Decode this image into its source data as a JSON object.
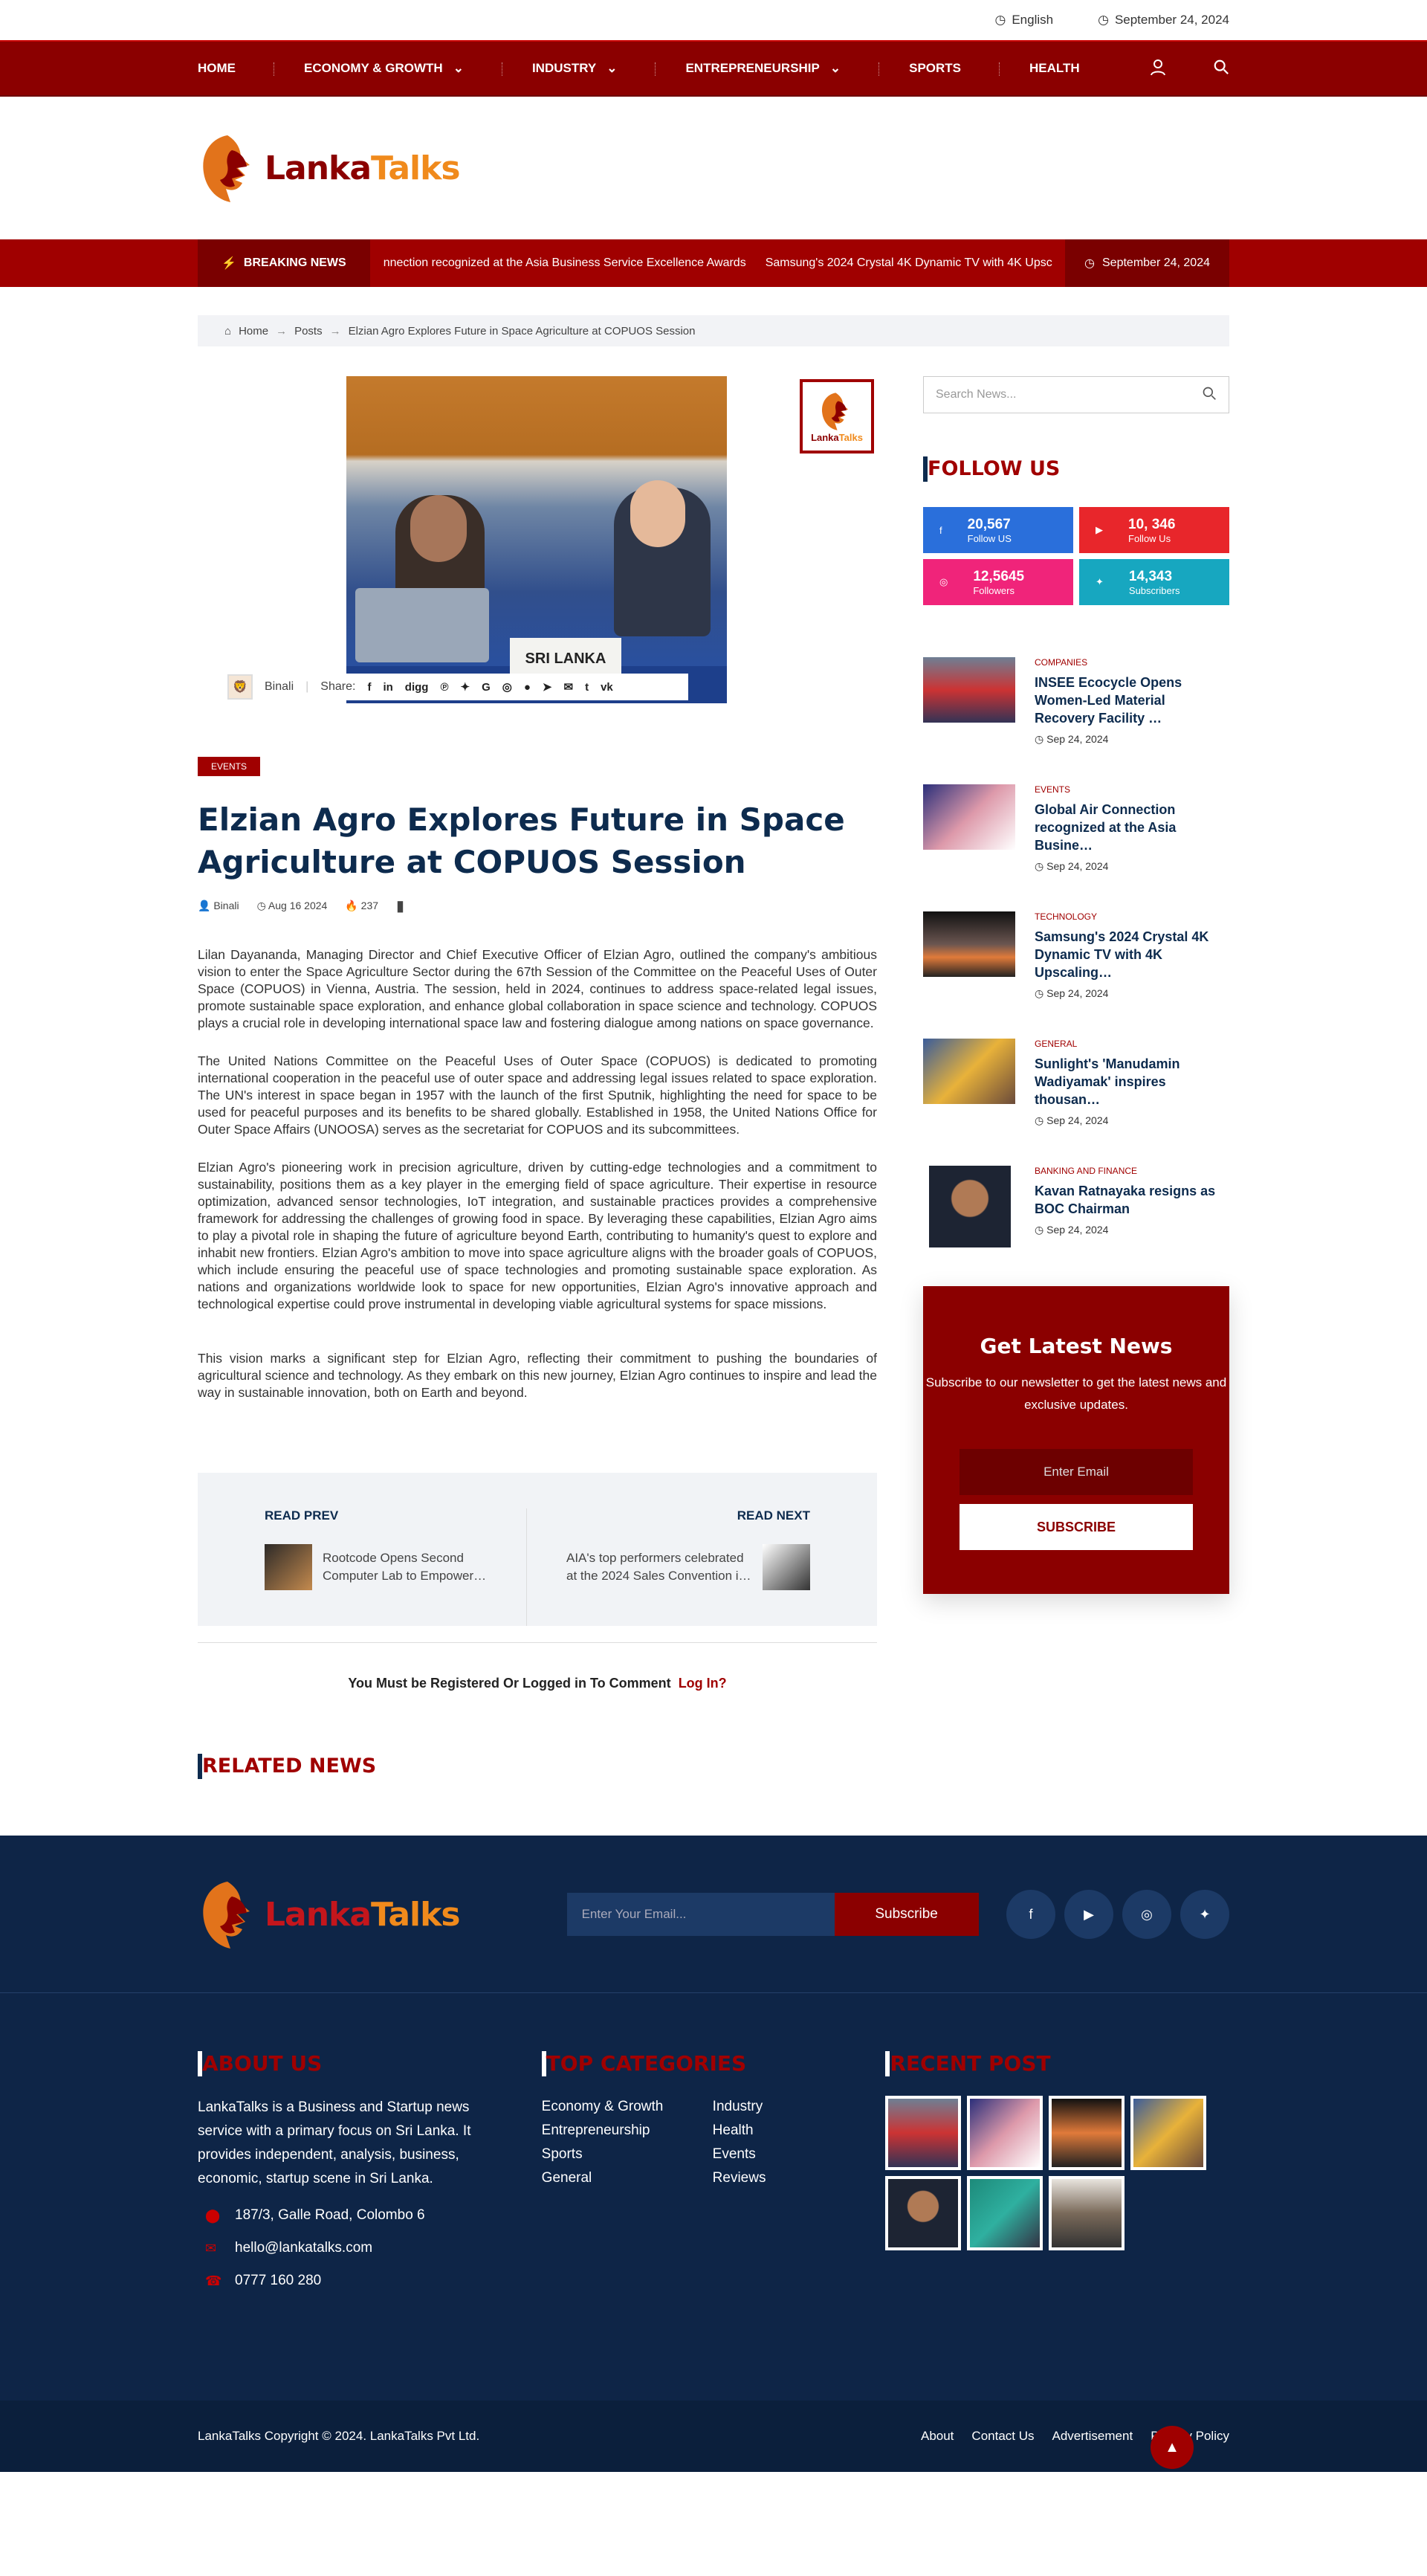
{
  "topbar": {
    "language": "English",
    "date": "September 24, 2024"
  },
  "nav": {
    "items": [
      "HOME",
      "ECONOMY & GROWTH",
      "INDUSTRY",
      "ENTREPRENEURSHIP",
      "SPORTS",
      "HEALTH"
    ]
  },
  "logo": {
    "lanka": "Lanka",
    "talks": "Talks"
  },
  "breaking": {
    "label": "BREAKING NEWS",
    "ticker1": "nnection recognized at the Asia Business Service Excellence Awards",
    "ticker2": "Samsung's 2024 Crystal 4K Dynamic TV with 4K Upsc",
    "date": "September 24, 2024"
  },
  "breadcrumb": {
    "home": "Home",
    "posts": "Posts",
    "current": "Elzian Agro Explores Future in Space Agriculture at COPUOS Session"
  },
  "article": {
    "plate": "SRI LANKA",
    "author": "Binali",
    "share_label": "Share:",
    "category": "EVENTS",
    "title": "Elzian Agro Explores Future in Space Agriculture at COPUOS Session",
    "meta_author": "Binali",
    "meta_date": "Aug 16 2024",
    "meta_views": "237",
    "p1": "Lilan Dayananda, Managing Director and Chief Executive Officer of Elzian Agro, outlined the company's ambitious vision to enter the Space Agriculture Sector during the 67th Session of the Committee on the Peaceful Uses of Outer Space (COPUOS) in Vienna, Austria. The session, held in 2024, continues to address space-related legal issues, promote sustainable space exploration, and enhance global collaboration in space science and technology. COPUOS plays a crucial role in developing international space law and fostering dialogue among nations on space governance.",
    "p2": "The United Nations Committee on the Peaceful Uses of Outer Space (COPUOS) is dedicated to promoting international cooperation in the peaceful use of outer space and addressing legal issues related to space exploration. The UN's interest in space began in 1957 with the launch of the first Sputnik, highlighting the need for space to be used for peaceful purposes and its benefits to be shared globally. Established in 1958, the United Nations Office for Outer Space Affairs (UNOOSA) serves as the secretariat for COPUOS and its subcommittees.",
    "p3": "Elzian Agro's pioneering work in precision agriculture, driven by cutting-edge technologies and a commitment to sustainability, positions them as a key player in the emerging field of space agriculture. Their expertise in resource optimization, advanced sensor technologies, IoT integration, and sustainable practices provides a comprehensive framework for addressing the challenges of growing food in space. By leveraging these capabilities, Elzian Agro aims to play a pivotal role in shaping the future of agriculture beyond Earth, contributing to humanity's quest to explore and inhabit new frontiers. Elzian Agro's ambition to move into space agriculture aligns with the broader goals of COPUOS, which include ensuring the peaceful use of space technologies and promoting sustainable space exploration. As nations and organizations worldwide look to space for new opportunities, Elzian Agro's innovative approach and technological expertise could prove instrumental in developing viable agricultural systems for space missions.",
    "p4": "This vision marks a significant step for Elzian Agro, reflecting their commitment to pushing the boundaries of agricultural science and technology. As they embark on this new journey, Elzian Agro continues to inspire and lead the way in sustainable innovation, both on Earth and beyond."
  },
  "readnav": {
    "prev_label": "READ PREV",
    "prev_title": "Rootcode Opens Second Computer Lab to Empower…",
    "next_label": "READ NEXT",
    "next_title": "AIA's top performers celebrated at the 2024 Sales Convention i…"
  },
  "comment": {
    "text": "You Must be Registered Or Logged in To Comment",
    "login": "Log In?"
  },
  "related_title": "RELATED NEWS",
  "sidebar": {
    "search_placeholder": "Search News...",
    "follow_title": "FOLLOW US",
    "socials": [
      {
        "count": "20,567",
        "label": "Follow US"
      },
      {
        "count": "10, 346",
        "label": "Follow Us"
      },
      {
        "count": "12,5645",
        "label": "Followers"
      },
      {
        "count": "14,343",
        "label": "Subscribers"
      }
    ],
    "posts": [
      {
        "category": "COMPANIES",
        "title": "INSEE Ecocycle Opens Women-Led Material Recovery Facility …",
        "date": "Sep 24, 2024"
      },
      {
        "category": "EVENTS",
        "title": "Global Air Connection recognized at the Asia Busine…",
        "date": "Sep 24, 2024"
      },
      {
        "category": "TECHNOLOGY",
        "title": "Samsung's 2024 Crystal 4K Dynamic TV with 4K Upscaling…",
        "date": "Sep 24, 2024"
      },
      {
        "category": "GENERAL",
        "title": "Sunlight's 'Manudamin Wadiyamak' inspires thousan…",
        "date": "Sep 24, 2024"
      },
      {
        "category": "BANKING AND FINANCE",
        "title": "Kavan Ratnayaka resigns as BOC Chairman",
        "date": "Sep 24, 2024"
      }
    ],
    "newsletter": {
      "title": "Get Latest News",
      "text": "Subscribe to our newsletter to get the latest news and exclusive updates.",
      "placeholder": "Enter Email",
      "button": "SUBSCRIBE"
    }
  },
  "footer": {
    "email_placeholder": "Enter Your Email...",
    "subscribe": "Subscribe",
    "about_title": "ABOUT US",
    "about_text": "LankaTalks is a Business and Startup news service with a primary focus on Sri Lanka. It provides independent, analysis, business, economic, startup scene in Sri Lanka.",
    "address": "187/3, Galle Road, Colombo 6",
    "email": "hello@lankatalks.com",
    "phone": "0777 160 280",
    "categories_title": "TOP CATEGORIES",
    "categories": [
      "Economy & Growth",
      "Industry",
      "Entrepreneurship",
      "Health",
      "Sports",
      "Events",
      "General",
      "Reviews"
    ],
    "recent_title": "RECENT POST",
    "copyright": "LankaTalks Copyright © 2024. LankaTalks Pvt Ltd.",
    "links": [
      "About",
      "Contact Us",
      "Advertisement",
      "Privacy Policy"
    ]
  },
  "colors": {
    "brand": "#8b0000",
    "navy": "#0e2547",
    "accent_orange": "#f08a1c"
  }
}
